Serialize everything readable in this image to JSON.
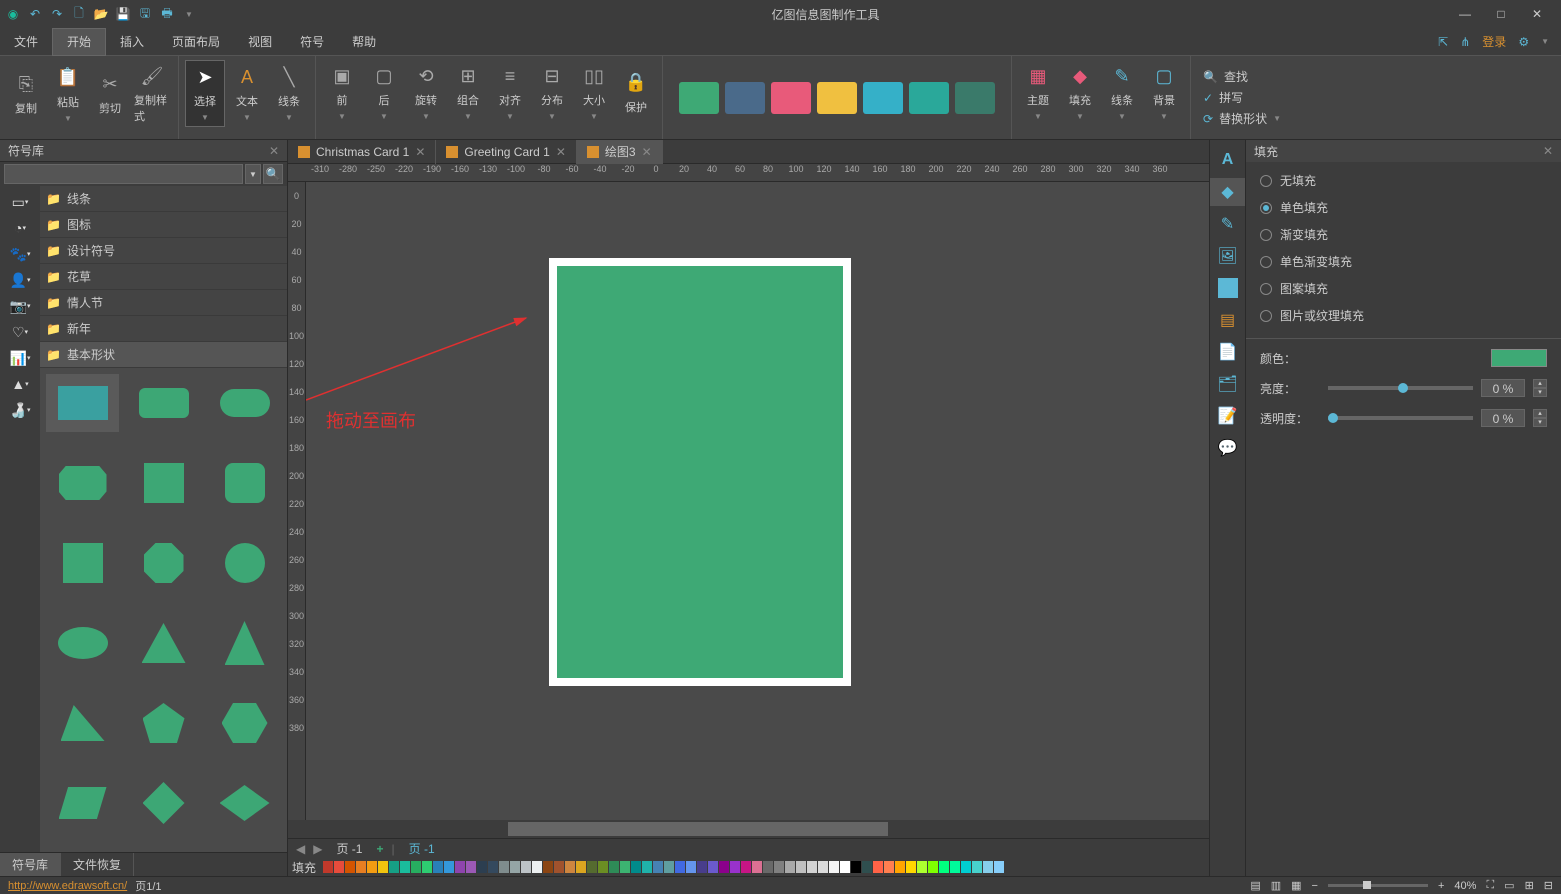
{
  "app_title": "亿图信息图制作工具",
  "quick_access": [
    "undo",
    "redo",
    "new",
    "open",
    "save",
    "save-as",
    "print"
  ],
  "window_controls": {
    "minimize": "—",
    "maximize": "□",
    "close": "✕"
  },
  "menubar": {
    "items": [
      "文件",
      "开始",
      "插入",
      "页面布局",
      "视图",
      "符号",
      "帮助"
    ],
    "active": "开始",
    "right": {
      "share_icon": "share",
      "login": "登录",
      "settings_icon": "gear"
    }
  },
  "ribbon": {
    "clipboard": {
      "copy": "复制",
      "paste": "粘贴",
      "cut": "剪切",
      "format_painter": "复制样式"
    },
    "tools": {
      "select": "选择",
      "text": "文本",
      "line": "线条"
    },
    "arrange": {
      "front": "前",
      "back": "后",
      "rotate": "旋转",
      "group": "组合",
      "align": "对齐",
      "distribute": "分布",
      "size": "大小",
      "protect": "保护"
    },
    "swatches": [
      "#3ea975",
      "#4a6a8a",
      "#e85a7a",
      "#f0c040",
      "#35b0c8",
      "#2aa89a",
      "#3a7a6a"
    ],
    "style": {
      "theme": "主题",
      "fill": "填充",
      "line": "线条",
      "background": "背景"
    },
    "find": {
      "find": "查找",
      "spell": "拼写",
      "replace_shape": "替换形状"
    }
  },
  "left_panel": {
    "title": "符号库",
    "search_placeholder": "",
    "category_icons": [
      "rect",
      "pie",
      "animal",
      "person",
      "camera",
      "heart",
      "chart",
      "triangle",
      "bottle"
    ],
    "categories": [
      "线条",
      "图标",
      "设计符号",
      "花草",
      "情人节",
      "新年",
      "基本形状"
    ],
    "active_category": "基本形状",
    "tabs": [
      "符号库",
      "文件恢复"
    ],
    "active_tab": "符号库"
  },
  "doc_tabs": [
    {
      "label": "Christmas Card 1",
      "active": false
    },
    {
      "label": "Greeting Card 1",
      "active": false
    },
    {
      "label": "绘图3",
      "active": true
    }
  ],
  "ruler_h": [
    "-310",
    "-280",
    "-250",
    "-220",
    "-190",
    "-160",
    "-130",
    "-100",
    "-80",
    "-60",
    "-40",
    "-20",
    "0",
    "20",
    "40",
    "60",
    "80",
    "100",
    "120",
    "140",
    "160",
    "180",
    "200",
    "220",
    "240",
    "260",
    "280",
    "300",
    "320",
    "340",
    "360"
  ],
  "ruler_v": [
    "0",
    "20",
    "40",
    "60",
    "80",
    "100",
    "120",
    "140",
    "160",
    "180",
    "200",
    "220",
    "240",
    "260",
    "280",
    "300",
    "320",
    "340",
    "360",
    "380"
  ],
  "annotation": "拖动至画布",
  "page_tabs": {
    "current": "页 -1",
    "link": "页 -1"
  },
  "color_strip": {
    "label": "填充",
    "colors": [
      "#c0392b",
      "#e74c3c",
      "#d35400",
      "#e67e22",
      "#f39c12",
      "#f1c40f",
      "#16a085",
      "#1abc9c",
      "#27ae60",
      "#2ecc71",
      "#2980b9",
      "#3498db",
      "#8e44ad",
      "#9b59b6",
      "#2c3e50",
      "#34495e",
      "#7f8c8d",
      "#95a5a6",
      "#bdc3c7",
      "#ecf0f1",
      "#8b4513",
      "#a0522d",
      "#cd853f",
      "#daa520",
      "#556b2f",
      "#6b8e23",
      "#2e8b57",
      "#3cb371",
      "#008b8b",
      "#20b2aa",
      "#4682b4",
      "#5f9ea0",
      "#4169e1",
      "#6495ed",
      "#483d8b",
      "#6a5acd",
      "#8b008b",
      "#9932cc",
      "#c71585",
      "#db7093",
      "#696969",
      "#808080",
      "#a9a9a9",
      "#c0c0c0",
      "#d3d3d3",
      "#dcdcdc",
      "#f5f5f5",
      "#ffffff",
      "#000000",
      "#2f4f4f",
      "#ff6347",
      "#ff7f50",
      "#ffa500",
      "#ffd700",
      "#adff2f",
      "#7fff00",
      "#00ff7f",
      "#00fa9a",
      "#00ced1",
      "#48d1cc",
      "#87ceeb",
      "#87cefa"
    ]
  },
  "right_panel": {
    "title": "填充",
    "icons": [
      "text",
      "fill",
      "line",
      "image",
      "color",
      "page",
      "doc",
      "layer",
      "comment"
    ],
    "active_icon": "fill",
    "fill_options": [
      "无填充",
      "单色填充",
      "渐变填充",
      "单色渐变填充",
      "图案填充",
      "图片或纹理填充"
    ],
    "active_fill": "单色填充",
    "color_label": "颜色：",
    "color_value": "#3ea975",
    "brightness_label": "亮度：",
    "brightness_value": "0 %",
    "opacity_label": "透明度：",
    "opacity_value": "0 %"
  },
  "statusbar": {
    "url": "http://www.edrawsoft.cn/",
    "page_info": "页1/1",
    "zoom": "40%"
  }
}
